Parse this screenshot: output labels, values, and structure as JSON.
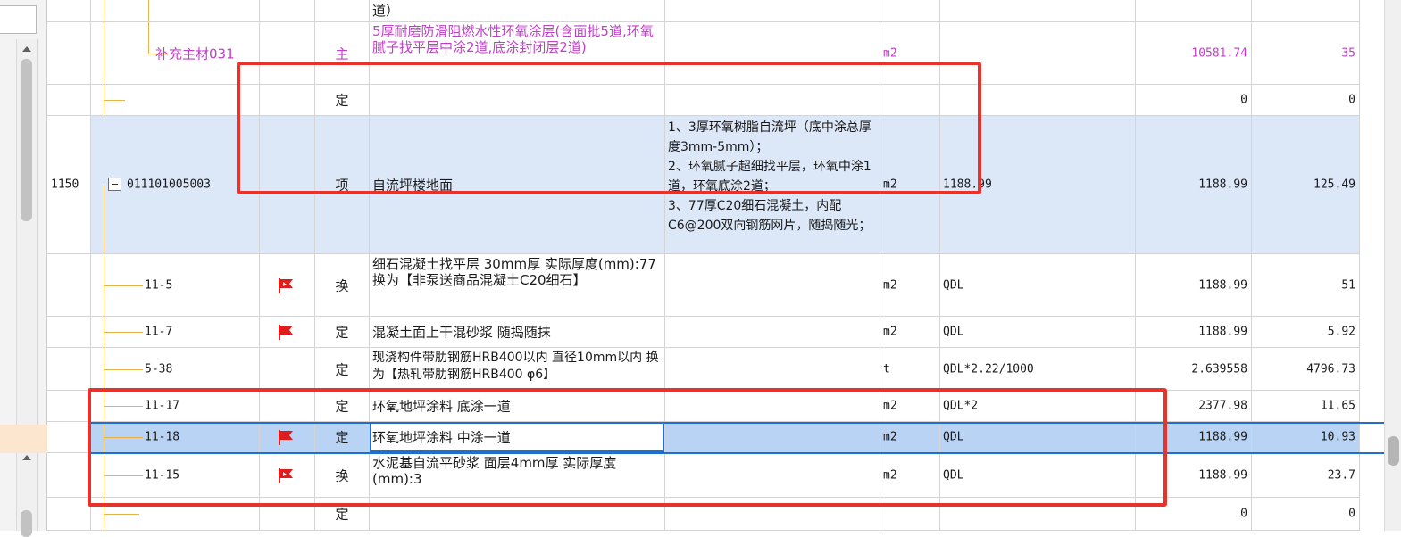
{
  "rows": [
    {
      "key": "r0",
      "desc": "道）",
      "class": "",
      "unit": "",
      "expr": "",
      "qty": "",
      "price": ""
    },
    {
      "key": "r1",
      "code": "补充主材031",
      "type": "主",
      "desc": "5厚耐磨防滑阻燃水性环氧涂层(含面批5道,环氧腻子找平层中涂2道,底涂封闭层2道)",
      "unit": "m2",
      "expr": "",
      "qty": "10581.74",
      "price": "35"
    },
    {
      "key": "r2",
      "code": "",
      "type": "定",
      "desc": "",
      "unit": "",
      "expr": "",
      "qty": "0",
      "price": "0"
    },
    {
      "key": "r3",
      "seq": "1150",
      "code": "011101005003",
      "type": "项",
      "desc": "自流坪楼地面",
      "feature": "1、3厚环氧树脂自流坪（底中涂总厚度3mm-5mm）；\n2、环氧腻子超细找平层，环氧中涂1道，环氧底涂2道；\n3、77厚C20细石混凝土，内配C6@200双向钢筋网片，随捣随光；",
      "unit": "m2",
      "expr": "1188.99",
      "qty": "1188.99",
      "price": "125.49"
    },
    {
      "key": "r4",
      "code": "11-5",
      "type": "换",
      "desc": "细石混凝土找平层 30mm厚  实际厚度(mm):77  换为【非泵送商品混凝土C20细石】",
      "unit": "m2",
      "expr": "QDL",
      "qty": "1188.99",
      "price": "51"
    },
    {
      "key": "r5",
      "code": "11-7",
      "type": "定",
      "desc": "混凝土面上干混砂浆 随捣随抹",
      "unit": "m2",
      "expr": "QDL",
      "qty": "1188.99",
      "price": "5.92"
    },
    {
      "key": "r6",
      "code": "5-38",
      "type": "定",
      "desc": "现浇构件带肋钢筋HRB400以内 直径10mm以内  换为【热轧带肋钢筋HRB400 φ6】",
      "unit": "t",
      "expr": "QDL*2.22/1000",
      "qty": "2.639558",
      "price": "4796.73"
    },
    {
      "key": "r7",
      "code": "11-17",
      "type": "定",
      "desc": "环氧地坪涂料 底涂一道",
      "unit": "m2",
      "expr": "QDL*2",
      "qty": "2377.98",
      "price": "11.65"
    },
    {
      "key": "r8",
      "code": "11-18",
      "type": "定",
      "desc": "环氧地坪涂料 中涂一道",
      "unit": "m2",
      "expr": "QDL",
      "qty": "1188.99",
      "price": "10.93"
    },
    {
      "key": "r9",
      "code": "11-15",
      "type": "换",
      "desc": "水泥基自流平砂浆 面层4mm厚  实际厚度(mm):3",
      "unit": "m2",
      "expr": "QDL",
      "qty": "1188.99",
      "price": "23.7"
    },
    {
      "key": "r10",
      "code": "",
      "type": "定",
      "desc": "",
      "unit": "",
      "expr": "",
      "qty": "0",
      "price": "0"
    }
  ],
  "icons": {
    "flag": "red-flag-icon",
    "collapse": "minus-toggle-icon"
  },
  "colors": {
    "accent_blue": "#1e6fd0",
    "selected_row": "#b8d3f3",
    "annotation_red": "#e8322c",
    "supplement_text": "#c03fc8",
    "flag_red": "#e01c1c"
  }
}
